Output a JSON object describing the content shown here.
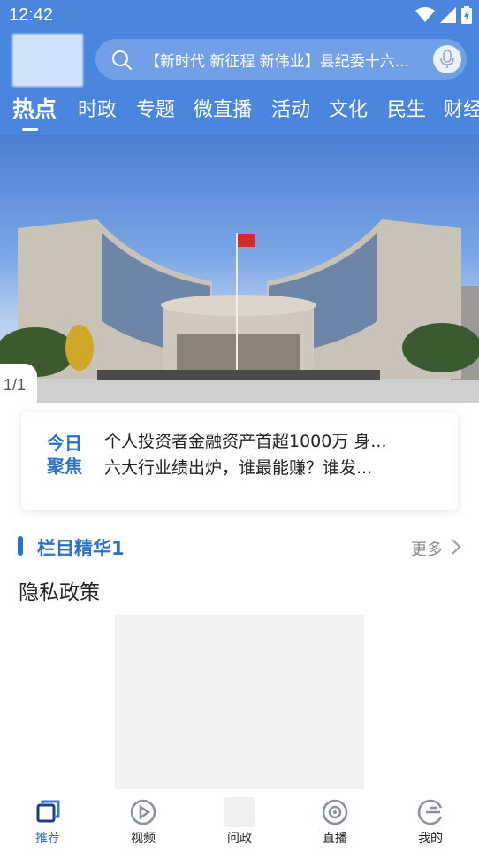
{
  "status_bar": {
    "time": "12:42"
  },
  "search": {
    "text": "【新时代 新征程 新伟业】县纪委十六..."
  },
  "tabs": [
    {
      "label": "热点",
      "active": true
    },
    {
      "label": "时政"
    },
    {
      "label": "专题"
    },
    {
      "label": "微直播"
    },
    {
      "label": "活动"
    },
    {
      "label": "文化"
    },
    {
      "label": "民生"
    },
    {
      "label": "财经"
    }
  ],
  "banner": {
    "counter": "1/1"
  },
  "focus": {
    "label_line1": "今日",
    "label_line2": "聚焦",
    "headlines": [
      "个人投资者金融资产首超1000万 身...",
      "六大行业绩出炉，谁最能赚？谁发..."
    ]
  },
  "section": {
    "title": "栏目精华1",
    "more_label": "更多",
    "article_title": "隐私政策"
  },
  "bottom_nav": [
    {
      "label": "推荐",
      "icon": "recommend-icon",
      "active": true
    },
    {
      "label": "视频",
      "icon": "video-icon"
    },
    {
      "label": "问政",
      "icon": "inquiry-icon"
    },
    {
      "label": "直播",
      "icon": "live-icon"
    },
    {
      "label": "我的",
      "icon": "profile-icon"
    }
  ],
  "colors": {
    "header": "#4a86dd",
    "accent": "#2a72c8"
  }
}
